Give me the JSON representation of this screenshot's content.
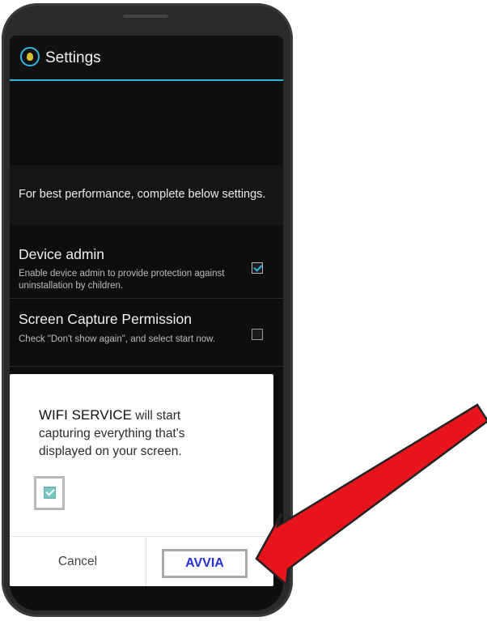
{
  "app_bar": {
    "title": "Settings",
    "icon": "app-shield-icon"
  },
  "notice": "For best performance, complete below settings.",
  "settings": [
    {
      "title": "Device admin",
      "description": "Enable device admin to provide protection against uninstallation by children.",
      "checked": true
    },
    {
      "title": "Screen Capture Permission",
      "description": "Check  \"Don't show again\", and select start now.",
      "checked": false
    }
  ],
  "dialog": {
    "app_name": "WIFI SERVICE",
    "message": " will start capturing everything that's displayed on your screen.",
    "checkbox_checked": true,
    "cancel_label": "Cancel",
    "start_label": "AVVIA"
  },
  "colors": {
    "accent": "#33b5e5",
    "arrow": "#e8141b",
    "start_text": "#2630d8"
  }
}
